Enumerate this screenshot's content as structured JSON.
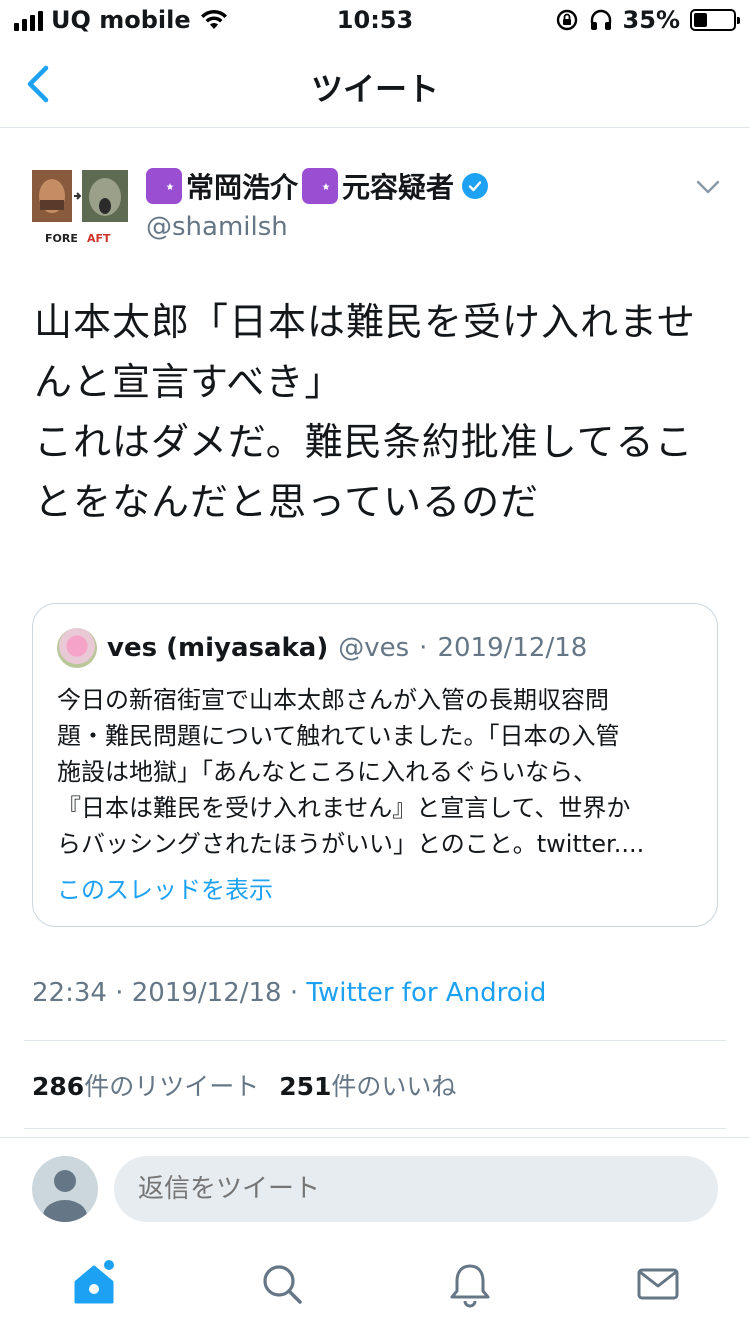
{
  "status_bar": {
    "carrier": "UQ mobile",
    "time": "10:53",
    "battery": "35%",
    "battery_level": 0.35
  },
  "nav": {
    "title": "ツイート",
    "back_icon": "chevron-left-icon"
  },
  "tweet": {
    "author_name": "常岡浩介",
    "author_name_suffix": "元容疑者",
    "handle": "@shamilsh",
    "avatar_labels": {
      "before": "FORE",
      "after": "AFT"
    },
    "text": "山本太郎「日本は難民を受け入れませんと宣言すべき」\nこれはダメだ。難民条約批准してることをなんだと思っているのだ",
    "time": "22:34",
    "date": "2019/12/18",
    "source": "Twitter for Android",
    "retweets": "286",
    "retweets_label": "件のリツイート",
    "likes": "251",
    "likes_label": "件のいいね"
  },
  "quote": {
    "name": "ves (miyasaka)",
    "handle": "@ves",
    "date": "2019/12/18",
    "text": "今日の新宿街宣で山本太郎さんが入管の長期収容問\n題・難民問題について触れていました。「日本の入管\n施設は地獄」「あんなところに入れるぐらいなら、\n『日本は難民を受け入れません』と宣言して、世界か\nらバッシングされたほうがいい」とのこと。twitter....",
    "show_thread": "このスレッドを表示"
  },
  "reply": {
    "placeholder": "返信をツイート"
  },
  "tabs": [
    "home-icon",
    "search-icon",
    "notifications-icon",
    "messages-icon"
  ],
  "colors": {
    "accent": "#1da1f2",
    "secondary_text": "#657786",
    "border": "#e1e8ed",
    "crescent_badge": "#9a4fd3"
  }
}
